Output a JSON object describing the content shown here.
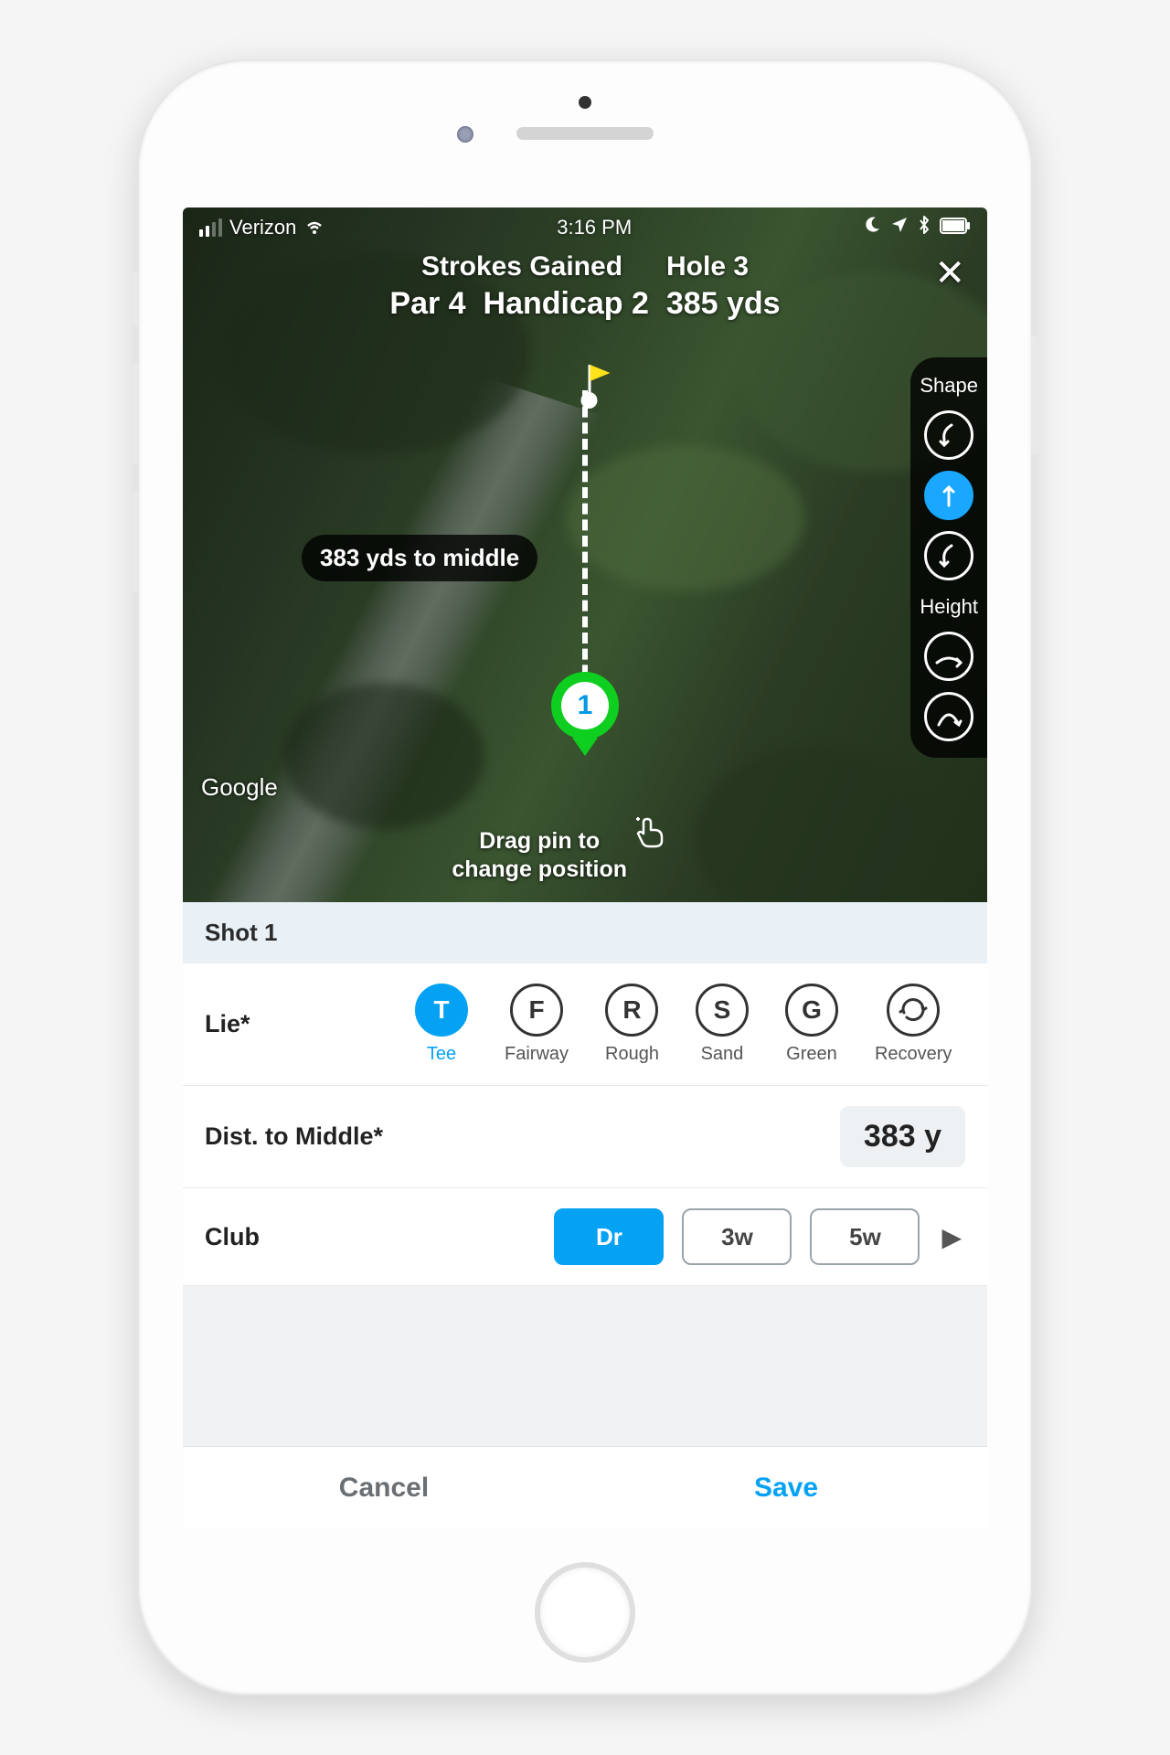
{
  "statusbar": {
    "carrier": "Verizon",
    "time": "3:16 PM"
  },
  "header": {
    "title_left": "Strokes Gained",
    "hole": "Hole 3",
    "par": "Par 4",
    "handicap": "Handicap 2",
    "yards": "385 yds"
  },
  "map": {
    "distance_pill": "383 yds to middle",
    "pin_number": "1",
    "attribution": "Google",
    "drag_hint_l1": "Drag pin to",
    "drag_hint_l2": "change position"
  },
  "sidepanel": {
    "shape_label": "Shape",
    "height_label": "Height"
  },
  "sheet": {
    "shot_header": "Shot 1",
    "lie_label": "Lie*",
    "lies": [
      {
        "abbr": "T",
        "name": "Tee",
        "selected": true
      },
      {
        "abbr": "F",
        "name": "Fairway"
      },
      {
        "abbr": "R",
        "name": "Rough"
      },
      {
        "abbr": "S",
        "name": "Sand"
      },
      {
        "abbr": "G",
        "name": "Green"
      },
      {
        "abbr": "",
        "name": "Recovery",
        "icon": true
      }
    ],
    "dist_label": "Dist. to Middle*",
    "dist_value": "383 y",
    "club_label": "Club",
    "clubs": [
      {
        "label": "Dr",
        "selected": true
      },
      {
        "label": "3w"
      },
      {
        "label": "5w"
      }
    ]
  },
  "footer": {
    "cancel": "Cancel",
    "save": "Save"
  }
}
